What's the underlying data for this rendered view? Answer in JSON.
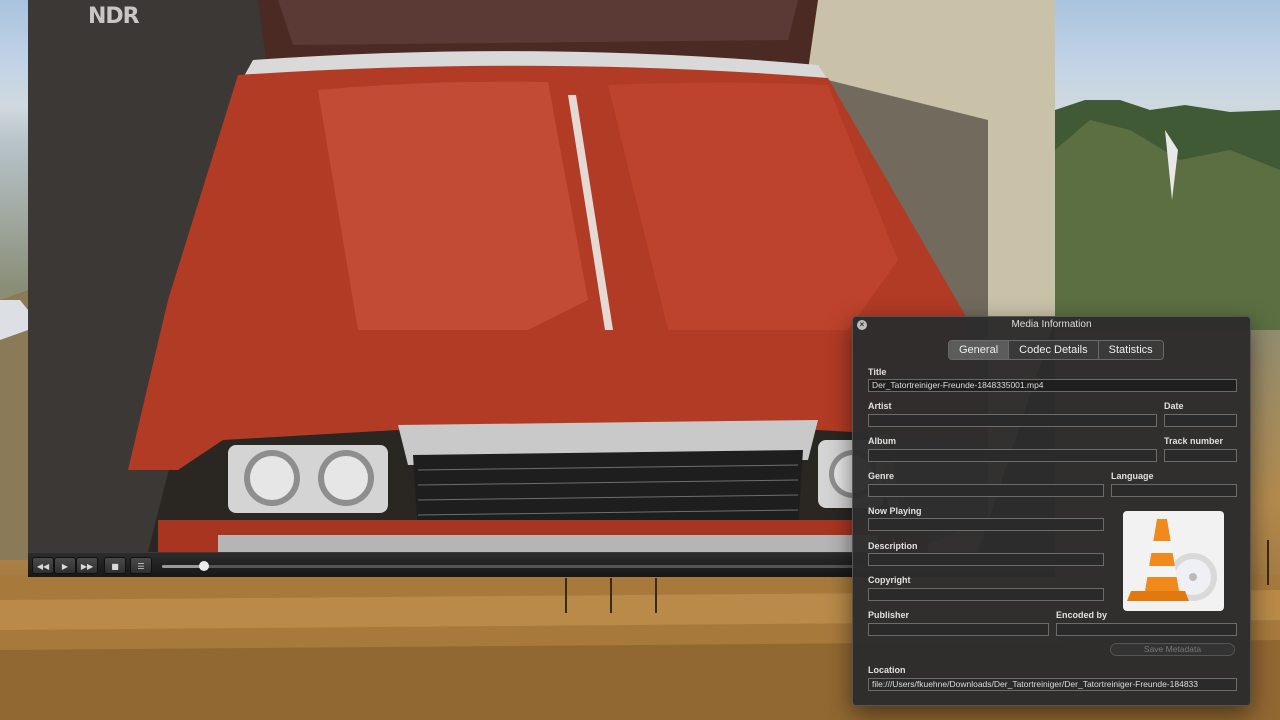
{
  "video": {
    "channel_logo": "NDR",
    "controls": {
      "rewind_icon": "rewind-icon",
      "play_icon": "play-icon",
      "forward_icon": "fast-forward-icon",
      "stop_icon": "stop-icon",
      "playlist_icon": "playlist-icon"
    },
    "playback_progress": 0.06
  },
  "media_info": {
    "window_title": "Media Information",
    "tabs": [
      {
        "label": "General",
        "active": true
      },
      {
        "label": "Codec Details",
        "active": false
      },
      {
        "label": "Statistics",
        "active": false
      }
    ],
    "fields": {
      "title_label": "Title",
      "title_value": "Der_Tatortreiniger-Freunde-1848335001.mp4",
      "artist_label": "Artist",
      "artist_value": "",
      "date_label": "Date",
      "date_value": "",
      "album_label": "Album",
      "album_value": "",
      "track_label": "Track number",
      "track_value": "",
      "genre_label": "Genre",
      "genre_value": "",
      "language_label": "Language",
      "language_value": "",
      "now_playing_label": "Now Playing",
      "now_playing_value": "",
      "description_label": "Description",
      "description_value": "",
      "copyright_label": "Copyright",
      "copyright_value": "",
      "publisher_label": "Publisher",
      "publisher_value": "",
      "encoded_by_label": "Encoded by",
      "encoded_by_value": "",
      "location_label": "Location",
      "location_value": "file:///Users/fkuehne/Downloads/Der_Tatortreiniger/Der_Tatortreiniger-Freunde-184833"
    },
    "save_button": "Save Metadata",
    "artwork_icon": "vlc-cone-icon"
  }
}
